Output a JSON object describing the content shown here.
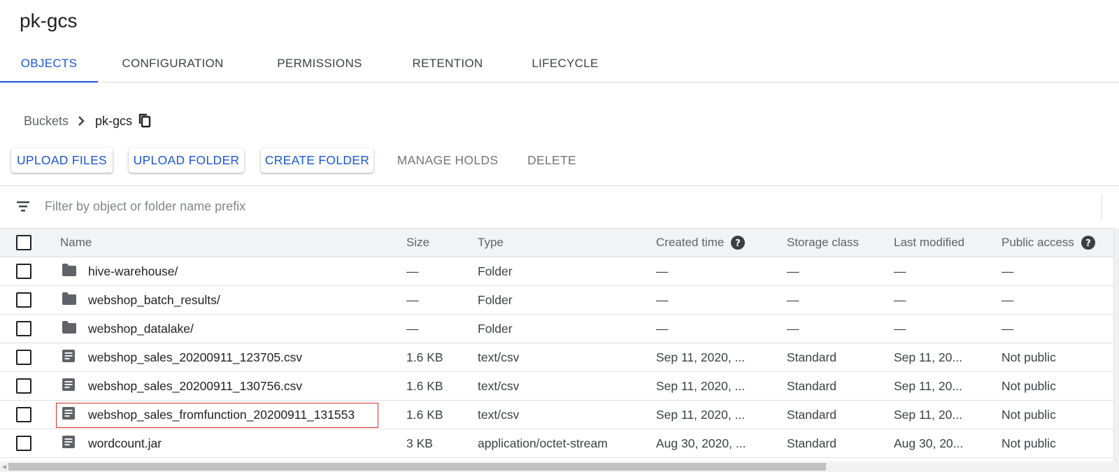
{
  "page": {
    "title": "pk-gcs"
  },
  "tabs": [
    {
      "label": "OBJECTS",
      "active": true
    },
    {
      "label": "CONFIGURATION",
      "active": false
    },
    {
      "label": "PERMISSIONS",
      "active": false
    },
    {
      "label": "RETENTION",
      "active": false
    },
    {
      "label": "LIFECYCLE",
      "active": false
    }
  ],
  "breadcrumb": {
    "root": "Buckets",
    "current": "pk-gcs"
  },
  "actions": {
    "upload_files": "UPLOAD FILES",
    "upload_folder": "UPLOAD FOLDER",
    "create_folder": "CREATE FOLDER",
    "manage_holds": "MANAGE HOLDS",
    "delete": "DELETE"
  },
  "filter": {
    "placeholder": "Filter by object or folder name prefix",
    "value": ""
  },
  "table": {
    "columns": [
      "Name",
      "Size",
      "Type",
      "Created time",
      "Storage class",
      "Last modified",
      "Public access"
    ],
    "rows": [
      {
        "icon": "folder-icon",
        "name": "hive-warehouse/",
        "size": "—",
        "type": "Folder",
        "created": "—",
        "storage_class": "—",
        "last_modified": "—",
        "public_access": "—",
        "highlighted": false
      },
      {
        "icon": "folder-icon",
        "name": "webshop_batch_results/",
        "size": "—",
        "type": "Folder",
        "created": "—",
        "storage_class": "—",
        "last_modified": "—",
        "public_access": "—",
        "highlighted": false
      },
      {
        "icon": "folder-icon",
        "name": "webshop_datalake/",
        "size": "—",
        "type": "Folder",
        "created": "—",
        "storage_class": "—",
        "last_modified": "—",
        "public_access": "—",
        "highlighted": false
      },
      {
        "icon": "file-icon",
        "name": "webshop_sales_20200911_123705.csv",
        "size": "1.6 KB",
        "type": "text/csv",
        "created": "Sep 11, 2020, ...",
        "storage_class": "Standard",
        "last_modified": "Sep 11, 20...",
        "public_access": "Not public",
        "highlighted": false
      },
      {
        "icon": "file-icon",
        "name": "webshop_sales_20200911_130756.csv",
        "size": "1.6 KB",
        "type": "text/csv",
        "created": "Sep 11, 2020, ...",
        "storage_class": "Standard",
        "last_modified": "Sep 11, 20...",
        "public_access": "Not public",
        "highlighted": false
      },
      {
        "icon": "file-icon",
        "name": "webshop_sales_fromfunction_20200911_131553",
        "size": "1.6 KB",
        "type": "text/csv",
        "created": "Sep 11, 2020, ...",
        "storage_class": "Standard",
        "last_modified": "Sep 11, 20...",
        "public_access": "Not public",
        "highlighted": true
      },
      {
        "icon": "file-icon",
        "name": "wordcount.jar",
        "size": "3 KB",
        "type": "application/octet-stream",
        "created": "Aug 30, 2020, ...",
        "storage_class": "Standard",
        "last_modified": "Aug 30, 20...",
        "public_access": "Not public",
        "highlighted": false
      }
    ]
  },
  "colors": {
    "accent": "#1a56d6",
    "highlight_border": "#d93025",
    "header_bg": "#f1f3f4",
    "icon": "#5f6368"
  }
}
